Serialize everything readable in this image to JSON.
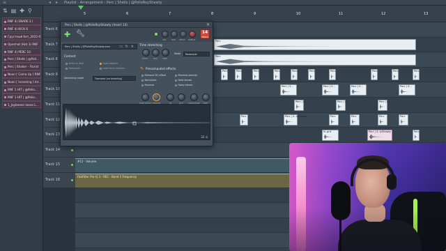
{
  "window": {
    "title": "Playlist - Arrangement › Perc | Shells | @PolloRoyShawty",
    "top_icons": [
      "≡",
      "◂",
      "▸"
    ]
  },
  "channel_list": {
    "tool_icons": [
      "⇅",
      "▤",
      "✚",
      "⚲"
    ],
    "items": [
      "RNF 4) SNARE 2 (",
      "RNF 4) KICK 6",
      "Грустный бит_2022-0…",
      "Openhat (Hat 3) RNF",
      "RNF 4) PERC 10",
      "Perc | Shells | @Poll…",
      "Perc | Shaker - Florist",
      "Noon [ Come Up ] RNF",
      "Noon [ Incoming ] Int…",
      "RNF 1 HIT | @Polio…",
      "RNF 1 HIT | @Polio…",
      "1_Jaybeeen loone L…"
    ]
  },
  "ruler": {
    "bars": [
      "5",
      "6",
      "7",
      "8",
      "9",
      "10",
      "11",
      "12",
      "13"
    ]
  },
  "tracks": [
    {
      "label": "Track 6"
    },
    {
      "label": "Track 7"
    },
    {
      "label": "Track 8"
    },
    {
      "label": "Track 9"
    },
    {
      "label": "Track 10"
    },
    {
      "label": "Track 11"
    },
    {
      "label": "Track 12"
    },
    {
      "label": "Track 13"
    },
    {
      "label": "Track 14"
    },
    {
      "label": "Track 15"
    },
    {
      "label": "Track 16"
    }
  ],
  "clips": {
    "perc": "Perc",
    "perc_shells": "Perc | S..lyShawty",
    "perc_long": "Perc | S..lyShawty",
    "perc_short": "Perc | S...",
    "ngrit": "N..grit",
    "automation_volume": "#12 - Volume",
    "automation_band": "FabFilter Pro-Q 3 - REC - Band 1 Frequency"
  },
  "channel_settings": {
    "title": "Perc | Shells | @PolloRoyShawty (Insert 14)",
    "head_knob_labels": [
      "VOL",
      "PAN",
      "PITCH",
      "RANGE"
    ],
    "track_label": "TRACK",
    "track_number": "14",
    "file_name": "Perc | Shells | @PolloRoyShawty.wav",
    "content_label": "Content",
    "content_options": [
      "Keep on disk",
      "Resample",
      "Load regions",
      "Load slice markers"
    ],
    "declicking_label": "Declicking mode",
    "declicking_value": "Transient (no bleeding)",
    "time_stretching_label": "Time stretching",
    "ts_knob_labels": [
      "PITCH",
      "MUL",
      "TIME"
    ],
    "mode_label": "Mode",
    "mode_value": "Resample",
    "precomputed_label": "Precomputed effects",
    "effects": [
      "Remove DC offset",
      "Normalize",
      "Reverse",
      "Reverse polarity",
      "Fade stereo",
      "Swap stereo"
    ],
    "effect_knob_labels": [
      "FADE IN/OUT",
      "LENGTH",
      "IN",
      "OUT",
      "CROSSFADE",
      "TRIM"
    ],
    "wave_footer": "32 ⊡"
  },
  "colors": {
    "accent_green": "#7ee06a",
    "accent_orange": "#f0a63c",
    "track_badge": "#c94a3d",
    "automation_teal": "#3f5a63",
    "automation_yellow": "#6b6644"
  }
}
